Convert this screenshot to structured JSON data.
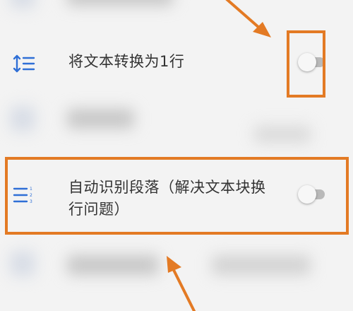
{
  "settings": {
    "items": [
      {
        "label": "将文本转换为1行",
        "icon": "line-spacing-icon",
        "toggle_state": "off"
      },
      {
        "label_line1": "自动识别段落（解决文本块换",
        "label_line2": "行问题）",
        "icon": "numbered-list-icon",
        "toggle_state": "off"
      }
    ]
  },
  "colors": {
    "background": "#f3f3f3",
    "icon_accent": "#2f6fd6",
    "annotation_orange": "#e37a24",
    "toggle_track_off": "#b9b9b9"
  }
}
